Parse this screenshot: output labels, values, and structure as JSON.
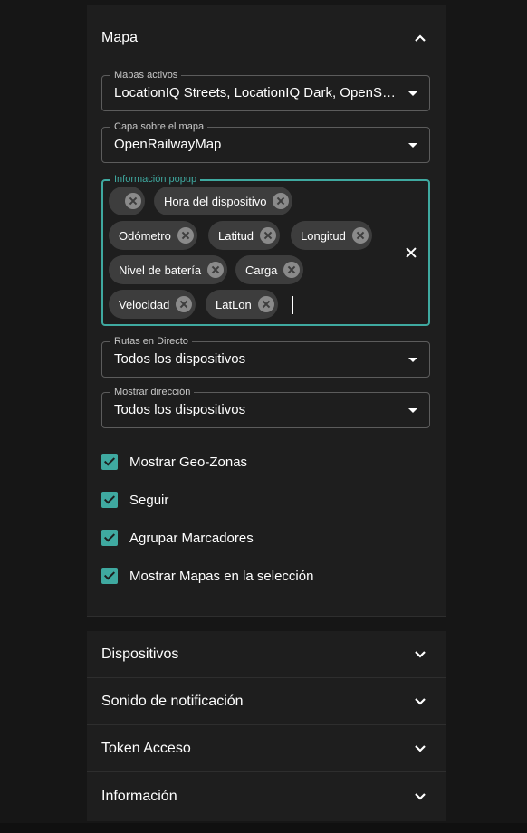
{
  "map_section": {
    "title": "Mapa",
    "chevron_icon": "chevron-up-icon",
    "active_maps": {
      "label": "Mapas activos",
      "value": "LocationIQ Streets, LocationIQ Dark, OpenStreetMap"
    },
    "overlay": {
      "label": "Capa sobre el mapa",
      "value": "OpenRailwayMap"
    },
    "popup_info": {
      "label": "Información popup",
      "chips": [
        "",
        "Hora del dispositivo",
        "Odómetro",
        "Latitud",
        "Longitud",
        "Nivel de batería",
        "Carga",
        "Velocidad",
        "LatLon"
      ],
      "remove_icon": "cancel-circle-icon",
      "clear_icon": "close-icon"
    },
    "live_routes": {
      "label": "Rutas en Directo",
      "value": "Todos los dispositivos"
    },
    "show_direction": {
      "label": "Mostrar dirección",
      "value": "Todos los dispositivos"
    },
    "checkboxes": [
      {
        "label": "Mostrar Geo-Zonas",
        "checked": true
      },
      {
        "label": "Seguir",
        "checked": true
      },
      {
        "label": "Agrupar Marcadores",
        "checked": true
      },
      {
        "label": "Mostrar Mapas en la selección",
        "checked": true
      }
    ],
    "accent_color": "#3fa9a0"
  },
  "collapsed_sections": [
    {
      "title": "Dispositivos"
    },
    {
      "title": "Sonido de notificación"
    },
    {
      "title": "Token Acceso"
    },
    {
      "title": "Información"
    }
  ]
}
